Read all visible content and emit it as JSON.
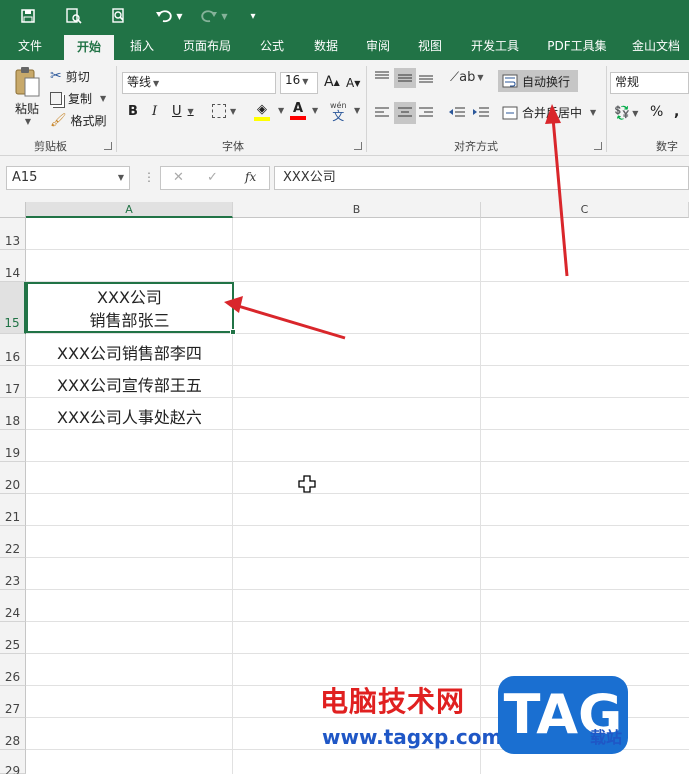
{
  "quick_access": {
    "save_icon": "save-icon",
    "print_preview_icon": "print-preview-icon",
    "find_icon": "find-icon",
    "undo_icon": "undo-icon",
    "redo_icon": "redo-icon",
    "customize_icon": "customize-icon"
  },
  "tabs": [
    "文件",
    "开始",
    "插入",
    "页面布局",
    "公式",
    "数据",
    "审阅",
    "视图",
    "开发工具",
    "PDF工具集",
    "金山文档"
  ],
  "clipboard": {
    "paste": "粘贴",
    "cut": "剪切",
    "copy": "复制",
    "format_painter": "格式刷",
    "group": "剪贴板"
  },
  "font": {
    "name": "等线",
    "size": "16",
    "grow": "A",
    "shrink": "A",
    "bold": "B",
    "italic": "I",
    "underline": "U",
    "phonetic": "wén",
    "phonetic2": "文",
    "group": "字体"
  },
  "alignment": {
    "wrap_text": "自动换行",
    "merge_center": "合并后居中",
    "group": "对齐方式"
  },
  "number": {
    "format": "常规",
    "percent": "%",
    "comma": ",",
    "group": "数字"
  },
  "formula_bar": {
    "cell_ref": "A15",
    "cancel": "✕",
    "enter": "✓",
    "fx": "fx",
    "content": "XXX公司"
  },
  "columns": [
    "A",
    "B",
    "C"
  ],
  "rows": [
    "13",
    "14",
    "15",
    "16",
    "17",
    "18",
    "19",
    "20",
    "21",
    "22",
    "23",
    "24",
    "25",
    "26",
    "27",
    "28",
    "29"
  ],
  "cells": {
    "a15_line1": "XXX公司",
    "a15_line2": "销售部张三",
    "a16": "XXX公司销售部李四",
    "a17": "XXX公司宣传部王五",
    "a18": "XXX公司人事处赵六"
  },
  "watermark": {
    "site_cn": "电脑技术网",
    "url": "www.tagxp.com",
    "tag": "TAG",
    "sub": "载站"
  },
  "colors": {
    "brand": "#217346",
    "arrow": "#d9262b"
  }
}
